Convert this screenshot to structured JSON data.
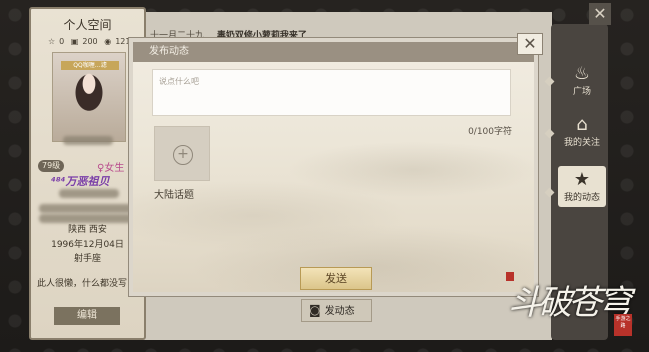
{
  "profile": {
    "title": "个人空间",
    "stats": {
      "likes": "0",
      "views": "200",
      "visitors": "121"
    },
    "avatar_tag": "QQ咖喱…滤",
    "level": "79级",
    "gender": "女生",
    "guild_name": "⁴⁸⁴万恶祖贝",
    "location": "陕西 西安",
    "birthday": "1996年12月04日",
    "zodiac": "射手座",
    "bio": "此人很懒，什么都没写",
    "edit_label": "编辑"
  },
  "feed": {
    "date": "十一月二十九",
    "title": "毒奶双修小萝莉我来了"
  },
  "nav": {
    "items": [
      {
        "label": "广场",
        "icon": "flame-icon"
      },
      {
        "label": "我的关注",
        "icon": "pavilion-icon"
      },
      {
        "label": "我的动态",
        "icon": "star-icon"
      }
    ]
  },
  "post_button": {
    "label": "发动态",
    "icon": "camera-icon"
  },
  "modal": {
    "title": "发布动态",
    "placeholder": "说点什么吧",
    "char_count": "0/100字符",
    "topic_label": "大陆话题",
    "send_label": "发送"
  },
  "logo": {
    "text": "斗破苍穹",
    "seal": "手游之路"
  },
  "colors": {
    "gender": "#b84c8c",
    "guild": "#7a3ea8",
    "send_button": "#dbc58a",
    "seal": "#b8322a"
  }
}
